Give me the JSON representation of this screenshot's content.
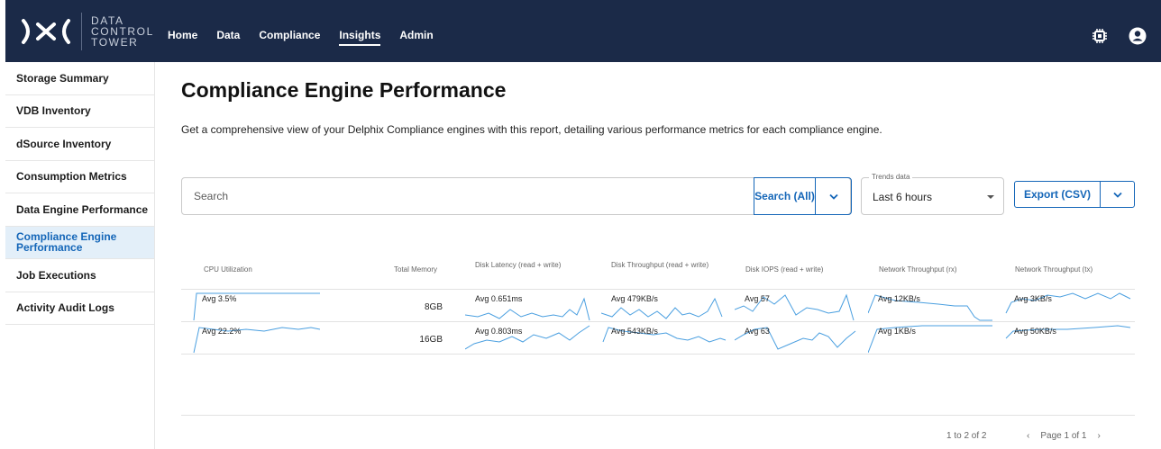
{
  "app": {
    "logo_text": [
      "DATA",
      "CONTROL",
      "TOWER"
    ],
    "nav": [
      "Home",
      "Data",
      "Compliance",
      "Insights",
      "Admin"
    ],
    "active_nav": "Insights",
    "icons": [
      "chip-icon",
      "user-icon"
    ]
  },
  "sidebar": {
    "items": [
      {
        "label": "Storage Summary"
      },
      {
        "label": "VDB Inventory"
      },
      {
        "label": "dSource Inventory"
      },
      {
        "label": "Consumption Metrics"
      },
      {
        "label": "Data Engine Performance"
      },
      {
        "label": "Compliance Engine Performance",
        "active": true
      },
      {
        "label": "Job Executions"
      },
      {
        "label": "Activity Audit Logs"
      }
    ]
  },
  "main": {
    "title": "Compliance Engine Performance",
    "description": "Get a comprehensive view of your Delphix Compliance engines with this report, detailing various performance metrics for each compliance engine.",
    "search": {
      "placeholder": "Search",
      "button_label": "Search (All)"
    },
    "trends": {
      "legend": "Trends data",
      "value": "Last 6 hours"
    },
    "export": {
      "label": "Export (CSV)"
    }
  },
  "table": {
    "columns": [
      "CPU Utilization",
      "Total Memory",
      "Disk Latency (read + write)",
      "Disk Throughput (read + write)",
      "Disk IOPS (read + write)",
      "Network Throughput (rx)",
      "Network Throughput (tx)"
    ],
    "rows": [
      {
        "cpu": "Avg 3.5%",
        "memory": "8GB",
        "latency": "Avg 0.651ms",
        "throughput": "Avg 479KB/s",
        "iops": "Avg 57",
        "net_rx": "Avg 12KB/s",
        "net_tx": "Avg 3KB/s"
      },
      {
        "cpu": "Avg 22.2%",
        "memory": "16GB",
        "latency": "Avg 0.803ms",
        "throughput": "Avg 543KB/s",
        "iops": "Avg 63",
        "net_rx": "Avg 1KB/s",
        "net_tx": "Avg 50KB/s"
      }
    ]
  },
  "pagination": {
    "count": "1 to 2 of 2",
    "page": "Page 1 of 1"
  },
  "colors": {
    "nav_bg": "#1b2a48",
    "accent": "#1466b8",
    "sparkline": "#4a9fe0",
    "active_bg": "#e3eff9"
  }
}
